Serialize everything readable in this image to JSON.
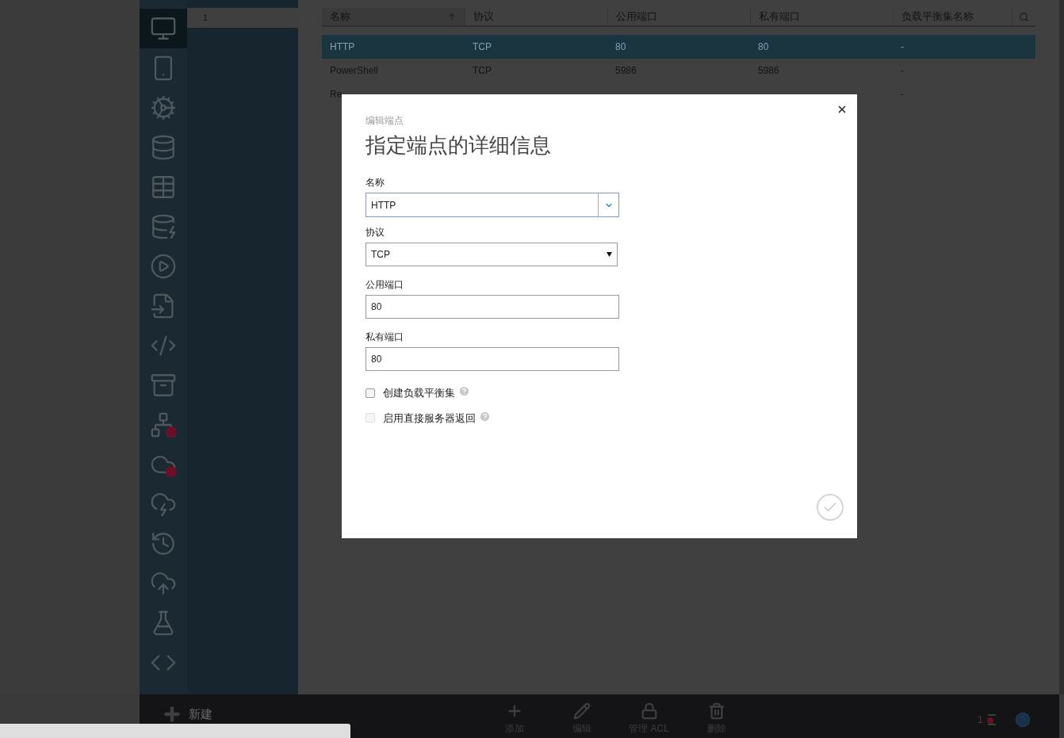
{
  "sidebar": {
    "items": [
      {
        "selected": true,
        "alert": false
      },
      {
        "selected": false,
        "alert": false
      },
      {
        "selected": false,
        "alert": false
      },
      {
        "selected": false,
        "alert": false
      },
      {
        "selected": false,
        "alert": false
      },
      {
        "selected": false,
        "alert": false
      },
      {
        "selected": false,
        "alert": false
      },
      {
        "selected": false,
        "alert": false
      },
      {
        "selected": false,
        "alert": false
      },
      {
        "selected": false,
        "alert": false
      },
      {
        "selected": false,
        "alert": true
      },
      {
        "selected": false,
        "alert": true
      },
      {
        "selected": false,
        "alert": false
      },
      {
        "selected": false,
        "alert": false
      },
      {
        "selected": false,
        "alert": false
      },
      {
        "selected": false,
        "alert": false
      },
      {
        "selected": false,
        "alert": false
      }
    ]
  },
  "subpanel": {
    "items": [
      {
        "label": "1",
        "selected": true
      }
    ]
  },
  "table": {
    "columns": [
      {
        "label": "名称",
        "sorted": true
      },
      {
        "label": "协议",
        "sorted": false
      },
      {
        "label": "公用端口",
        "sorted": false
      },
      {
        "label": "私有端口",
        "sorted": false
      },
      {
        "label": "负载平衡集名称",
        "sorted": false
      }
    ],
    "rows": [
      {
        "cells": [
          "HTTP",
          "TCP",
          "80",
          "80",
          "-"
        ],
        "selected": true
      },
      {
        "cells": [
          "PowerShell",
          "TCP",
          "5986",
          "5986",
          "-"
        ],
        "selected": false
      },
      {
        "cells": [
          "Re",
          null,
          null,
          null,
          "-"
        ],
        "selected": false
      }
    ]
  },
  "toolbar": {
    "new_label": "新建",
    "actions": [
      {
        "kind": "add",
        "label": "添加"
      },
      {
        "kind": "edit",
        "label": "编辑"
      },
      {
        "kind": "acl",
        "label": "管理 ACL"
      },
      {
        "kind": "delete",
        "label": "删除"
      }
    ],
    "status_count": "1"
  },
  "dialog": {
    "subtitle": "编辑端点",
    "title": "指定端点的详细信息",
    "fields": [
      {
        "kind": "combo",
        "label": "名称",
        "value": "HTTP"
      },
      {
        "kind": "select",
        "label": "协议",
        "value": "TCP"
      },
      {
        "kind": "text",
        "label": "公用端口",
        "value": "80"
      },
      {
        "kind": "text",
        "label": "私有端口",
        "value": "80"
      }
    ],
    "options": [
      {
        "label": "创建负载平衡集",
        "checked": false,
        "disabled": false
      },
      {
        "label": "启用直接服务器返回",
        "checked": false,
        "disabled": true
      }
    ]
  }
}
